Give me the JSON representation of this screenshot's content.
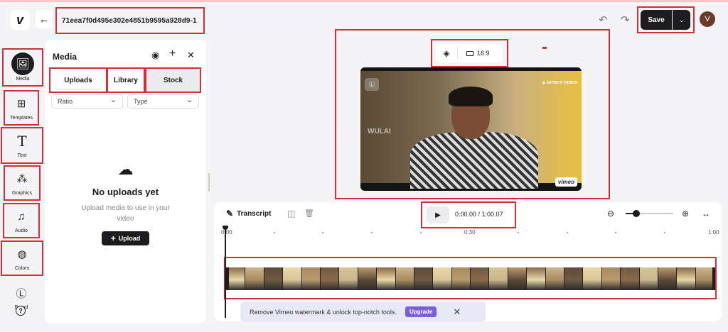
{
  "topbar": {
    "logo": "v",
    "back_icon": "←",
    "filename": "71eea7f0d495e302e4851b9595a928d9-1",
    "undo_icon": "↶",
    "redo_icon": "↷",
    "save_label": "Save",
    "save_dropdown_icon": "⌄",
    "avatar_initial": "V"
  },
  "rail": {
    "items": [
      {
        "label": "Media",
        "icon": "🖼"
      },
      {
        "label": "Templates",
        "icon": "⊞"
      },
      {
        "label": "Text",
        "icon": "T"
      },
      {
        "label": "Graphics",
        "icon": "⁂"
      },
      {
        "label": "Audio",
        "icon": "♫"
      },
      {
        "label": "Colors",
        "icon": "◍"
      },
      {
        "label": "Brand",
        "icon": "Ⓛ"
      }
    ],
    "help_icon": "?"
  },
  "media_panel": {
    "title": "Media",
    "tabs": {
      "uploads": "Uploads",
      "library": "Library",
      "stock": "Stock"
    },
    "ratio_select": "Ratio",
    "type_select": "Type",
    "chevron": "⌄",
    "empty_title": "No uploads yet",
    "empty_sub": "Upload media to use in your video",
    "upload_label": "Upload",
    "upload_plus": "+",
    "icons": {
      "record": "◉",
      "add": "+",
      "close": "✕",
      "cloud": "☁"
    }
  },
  "stage": {
    "fill_icon": "◈",
    "ratio_label": "16:9",
    "video": {
      "badge": "Ⓛ",
      "channel": "▶ SATISH K VIDEOS",
      "watermark": "WULAI",
      "vimeo_badge": "vimeo"
    }
  },
  "timeline": {
    "transcript_label": "Transcript",
    "transcript_icon": "✎",
    "split_icon": "◫",
    "delete_icon": "🗑",
    "play_icon": "▶",
    "timecode": "0:00.00 / 1:00.07",
    "zoom_out_icon": "⊖",
    "zoom_in_icon": "⊕",
    "fit_icon": "↔",
    "zoom_level": 0.22,
    "ruler": {
      "start": "0:00",
      "mid": "0:30",
      "end": "1:00"
    }
  },
  "banner": {
    "text": "Remove Vimeo watermark & unlock top-notch tools.",
    "upgrade": "Upgrade",
    "close_icon": "✕"
  }
}
